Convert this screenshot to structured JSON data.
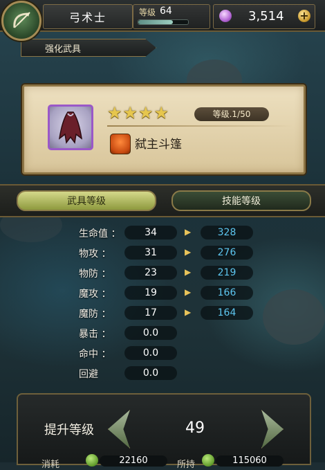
{
  "header": {
    "class_name": "弓术士",
    "level_label": "等级",
    "level_value": "64",
    "gems": "3,514"
  },
  "section_tab": "强化武具",
  "item": {
    "stars": "★★★★",
    "grade": "等级.1/50",
    "name": "弑主斗篷"
  },
  "tabs": {
    "weapon_level": "武具等级",
    "skill_level": "技能等级"
  },
  "stats": [
    {
      "label": "生命值 ：",
      "current": "34",
      "next": "328"
    },
    {
      "label": "物攻 ：",
      "current": "31",
      "next": "276"
    },
    {
      "label": "物防 ：",
      "current": "23",
      "next": "219"
    },
    {
      "label": "魔攻 ：",
      "current": "19",
      "next": "166"
    },
    {
      "label": "魔防 ：",
      "current": "17",
      "next": "164"
    },
    {
      "label": "暴击 ：",
      "current": "0.0",
      "next": ""
    },
    {
      "label": "命中 ：",
      "current": "0.0",
      "next": ""
    },
    {
      "label": "回避",
      "current": "0.0",
      "next": ""
    }
  ],
  "upgrade": {
    "label": "提升等级",
    "value": "49",
    "cost_label": "消耗",
    "cost_value": "22160",
    "owned_label": "所持",
    "owned_value": "115060"
  },
  "colors": {
    "next_value": "#5dc6f0",
    "star": "#e6c64d",
    "frame_gold": "#8c7444"
  }
}
